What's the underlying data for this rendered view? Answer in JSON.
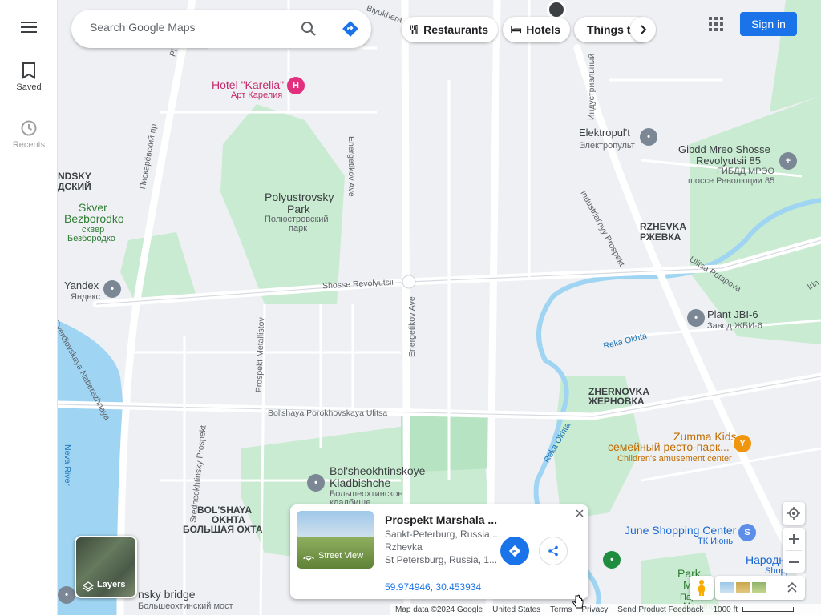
{
  "rail": {
    "saved_label": "Saved",
    "recents_label": "Recents"
  },
  "search": {
    "placeholder": "Search Google Maps"
  },
  "chips": {
    "restaurants": "Restaurants",
    "hotels": "Hotels",
    "things": "Things to do"
  },
  "header": {
    "sign_in": "Sign in"
  },
  "map_labels": {
    "hotel_karelia": "Hotel \"Karelia\"",
    "hotel_karelia_ru": "Арт Карелия",
    "elektropult": "Elektropul't",
    "elektropult_ru": "Электропульт",
    "gibdd": "Gibdd Mreo Shosse",
    "gibdd2": "Revolyutsii 85",
    "gibdd_ru": "ГИБДД МРЭО",
    "gibdd_ru2": "шоссе Революции 85",
    "polyustrovsky": "Polyustrovsky",
    "polyustrovsky2": "Park",
    "polyustrovsky_ru": "Полюстровский",
    "polyustrovsky_ru2": "парк",
    "skver": "Skver",
    "skver2": "Bezborodko",
    "skver_ru": "сквер",
    "skver_ru2": "Безбородко",
    "ndsky": "NDSKY",
    "ndsky_ru": "ДСКИЙ",
    "rzhevka": "RZHEVKA",
    "rzhevka_ru": "РЖЕВКА",
    "yandex": "Yandex",
    "yandex_ru": "Яндекс",
    "plant": "Plant JBI-6",
    "plant_ru": "Завод ЖБИ-6",
    "zhernovka": "ZHERNOVKA",
    "zhernovka_ru": "ЖЕРНОВКА",
    "zumma": "Zumma Kids,",
    "zumma2": "семейный ресто-парк...",
    "zumma3": "Children's amusement center",
    "kladbishche": "Bol'sheokhtinskoye",
    "kladbishche2": "Kladbishche",
    "kladbishche_ru": "Большеохтинское",
    "kladbishche_ru2": "кладбище",
    "okhta": "BOL'SHAYA",
    "okhta2": "OKHTA",
    "okhta_ru": "БОЛЬШАЯ ОХТА",
    "june": "June Shopping Center",
    "june_ru": "ТК Июнь",
    "narodny": "Народн",
    "narodny2": "Shoppi",
    "park_malin": "Park",
    "park_malin2": "Malin",
    "park_malin_ru": "Парк",
    "park_malin_ru2": "Малинов",
    "bridge": "nsky bridge",
    "bridge_ru": "Большеохтинский мост",
    "neva": "Neva River",
    "road_shosse": "Shosse Revolyutsii",
    "road_energetikov": "Energetikov Ave",
    "road_energetikov2": "Energetikov Ave",
    "road_metallistov": "Prospekt Metallistov",
    "road_porokh": "Bol'shaya Porokhovskaya Ulitsa",
    "road_sredneokh": "Sredneokhtinsky Prospekt",
    "road_sverdl": "Sverdlovskaya Naberezhnaya",
    "road_industr": "Industrial'nyy Prospekt",
    "road_industr_ru": "Индустриальный",
    "road_potapova": "Ulitsa Potapova",
    "road_okhta": "Reka Okhta",
    "road_okhta2": "Reka Okhta",
    "road_piskar": "Пискарёвский пр",
    "road_blyukhera": "Blyukhera",
    "road_irin": "Irin",
    "road_pi": "Pi"
  },
  "card": {
    "title": "Prospekt Marshala ...",
    "line1": "Sankt-Peterburg, Russia,...",
    "line2": "Rzhevka",
    "line3": "St Petersburg, Russia, 1...",
    "street_view": "Street View",
    "coords": "59.974946, 30.453934"
  },
  "layers": {
    "label": "Layers"
  },
  "footer": {
    "map_data": "Map data ©2024 Google",
    "country": "United States",
    "terms": "Terms",
    "privacy": "Privacy",
    "feedback": "Send Product Feedback",
    "scale": "1000 ft"
  },
  "colors": {
    "accent": "#1a73e8",
    "park": "#c8ebd1",
    "water": "#9fd5f3",
    "poi_pink": "#e2307e",
    "poi_orange": "#f0950e",
    "poi_grey": "#7b8794"
  }
}
